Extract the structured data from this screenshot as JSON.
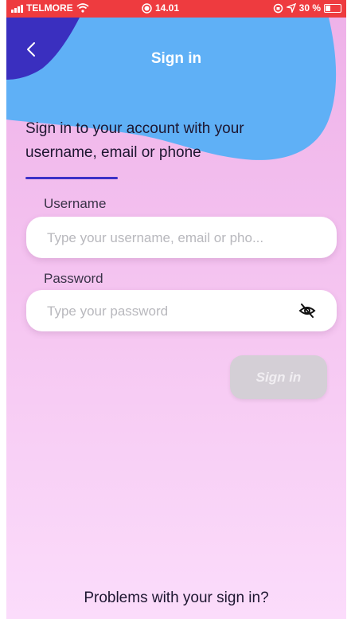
{
  "status_bar": {
    "carrier": "TELMORE",
    "time": "14.01",
    "battery": "30 %"
  },
  "header": {
    "title": "Sign in",
    "back_icon": "chevron-left-icon"
  },
  "intro_text": "Sign in to your account with your username, email or phone",
  "form": {
    "username_label": "Username",
    "username_placeholder": "Type your username, email or pho...",
    "password_label": "Password",
    "password_placeholder": "Type your password",
    "password_toggle_icon": "eye-off-icon",
    "submit_label": "Sign in"
  },
  "footer": {
    "problems_link": "Problems with your sign in?"
  },
  "colors": {
    "status_bar": "#ee3b3f",
    "blob_light": "#5fb0f6",
    "blob_dark": "#3a2fbf",
    "accent": "#3d31c8",
    "button_disabled": "#d4cfd6"
  }
}
